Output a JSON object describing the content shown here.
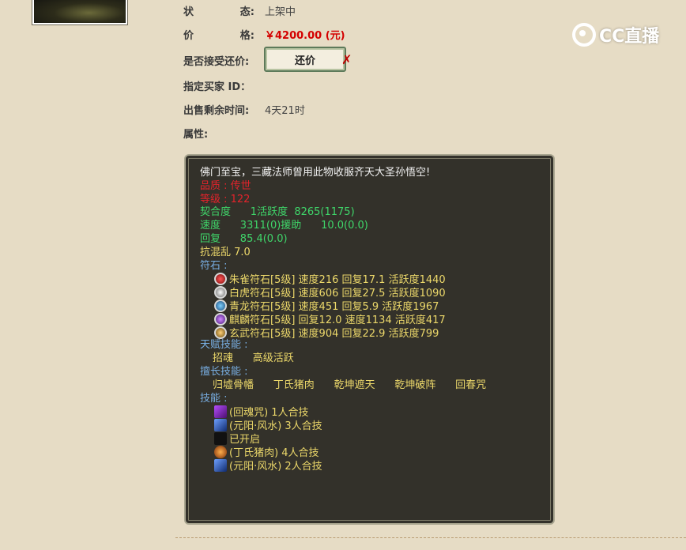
{
  "logo": {
    "text": "CC直播"
  },
  "status": {
    "label_a": "状",
    "label_b": "态:",
    "value": "上架中"
  },
  "price": {
    "label_a": "价",
    "label_b": "格:",
    "value": "￥4200.00 (元)"
  },
  "haggle": {
    "label": "是否接受还价:",
    "button": "还价"
  },
  "buyer": {
    "label": "指定买家 ID："
  },
  "remaining": {
    "label": "出售剩余时间:",
    "value": "4天21时"
  },
  "attrs": {
    "label": "属性:"
  },
  "panel": {
    "desc": "佛门至宝，三藏法师曾用此物收服齐天大圣孙悟空!",
    "quality": "品质 : 传世",
    "level": "等级 : 122",
    "affinity": "契合度      1活跃度  8265(1175)",
    "speed": "速度      3311(0)援助      10.0(0.0)",
    "recovery": "回复      85.4(0.0)",
    "anti_chaos": "抗混乱 7.0",
    "runes_label": "符石 :",
    "runes": [
      {
        "icon": "zhuque-rune-icon",
        "text": "朱雀符石[5级] 速度216 回复17.1 活跃度1440"
      },
      {
        "icon": "baihu-rune-icon",
        "text": "白虎符石[5级] 速度606 回复27.5 活跃度1090"
      },
      {
        "icon": "qinglong-rune-icon",
        "text": "青龙符石[5级] 速度451 回复5.9 活跃度1967"
      },
      {
        "icon": "qilin-rune-icon",
        "text": "麒麟符石[5级] 回复12.0 速度1134 活跃度417"
      },
      {
        "icon": "xuanwu-rune-icon",
        "text": "玄武符石[5级] 速度904 回复22.9 活跃度799"
      }
    ],
    "talent_label": "天赋技能 :",
    "talents": "招魂      高级活跃",
    "specialty_label": "擅长技能 :",
    "specialties": "归墟骨幡      丁氏猪肉      乾坤遮天      乾坤破阵      回春咒",
    "skills_label": "技能 :",
    "skills": [
      {
        "icon": "huihun-skill-icon",
        "text": "(回魂咒) 1人合技"
      },
      {
        "icon": "yuanyang-skill-icon",
        "text": "(元阳·风水) 3人合技"
      },
      {
        "icon": "opened-skill-icon",
        "text": "已开启"
      },
      {
        "icon": "dingshi-skill-icon",
        "text": "(丁氏猪肉) 4人合技"
      },
      {
        "icon": "yuanyang-skill-icon-2",
        "text": "(元阳·风水) 2人合技"
      }
    ]
  }
}
